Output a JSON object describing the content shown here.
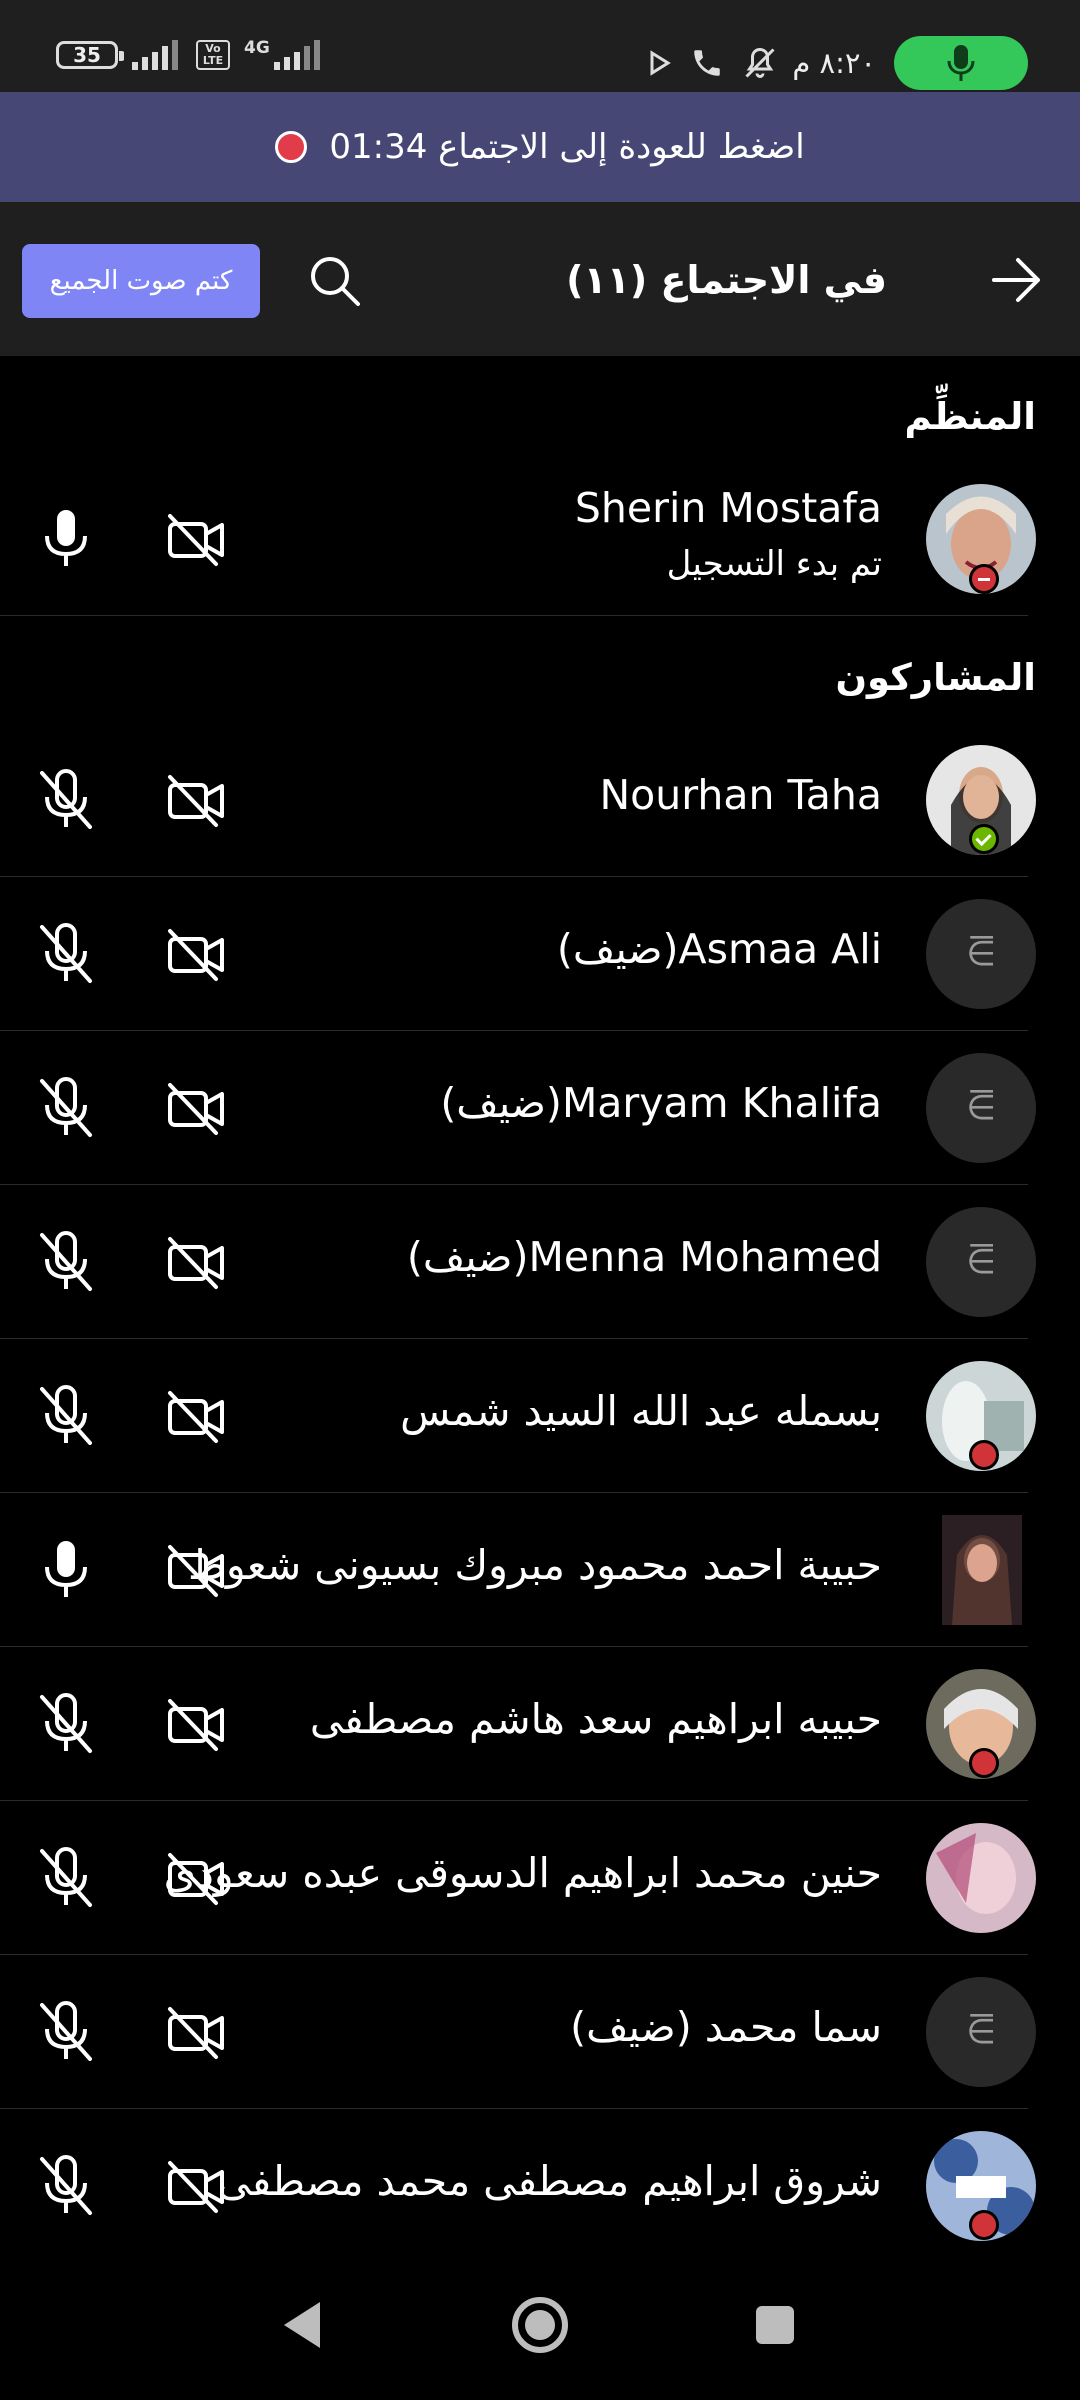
{
  "status_bar": {
    "battery": "35",
    "volte": [
      "Vo",
      "LTE"
    ],
    "network": "4G",
    "time": "٨:٢٠ م"
  },
  "banner": {
    "text": "اضغط للعودة إلى الاجتماع 01:34"
  },
  "header": {
    "title": "في الاجتماع (١١)",
    "mute_all": "كتم صوت الجميع"
  },
  "sections": {
    "organizer": "المنظِّم",
    "participants": "المشاركون"
  },
  "organizer": {
    "name": "Sherin Mostafa",
    "subtitle": "تم بدء التسجيل"
  },
  "participants": [
    {
      "name": "Nourhan Taha"
    },
    {
      "name": "Asmaa Ali(ضيف)"
    },
    {
      "name": "Maryam Khalifa(ضيف)"
    },
    {
      "name": "Menna Mohamed(ضيف)"
    },
    {
      "name": "بسمله عبد الله السيد شمس"
    },
    {
      "name": "حبيبة احمد محمود مبروك بسيونى شعوط"
    },
    {
      "name": "حبيبه ابراهيم سعد هاشم مصطفى"
    },
    {
      "name": "حنين محمد ابراهيم الدسوقى عبده سعودى"
    },
    {
      "name": "سما محمد (ضيف)"
    },
    {
      "name": "شروق ابراهيم مصطفى محمد مصطفى"
    }
  ],
  "colors": {
    "accent": "#7f85f5",
    "banner": "#464775",
    "recording": "#e23b4a",
    "mic_active": "#34c759"
  }
}
